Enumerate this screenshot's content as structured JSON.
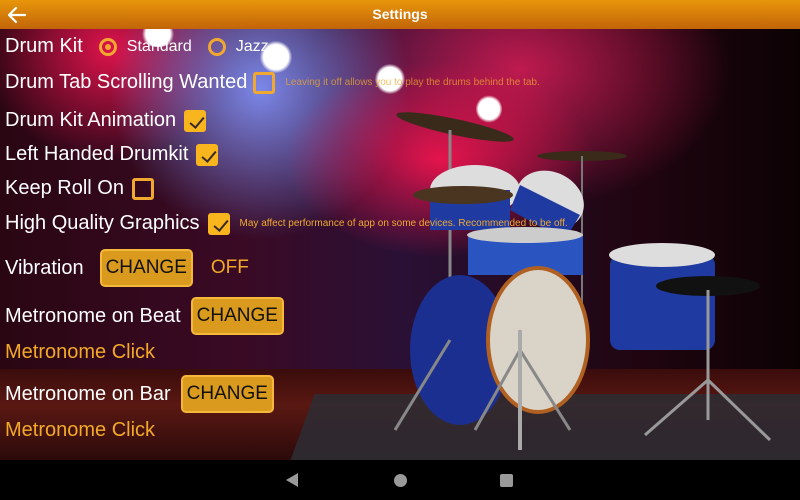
{
  "appbar": {
    "title": "Settings",
    "back_icon": "arrow-left-icon"
  },
  "settings": {
    "drum_kit": {
      "label": "Drum Kit",
      "options": [
        {
          "label": "Standard",
          "selected": true
        },
        {
          "label": "Jazz",
          "selected": false
        }
      ]
    },
    "drum_tab_scrolling": {
      "label": "Drum Tab Scrolling Wanted",
      "checked": false,
      "hint": "Leaving it off allows you to play the drums behind the tab."
    },
    "drum_kit_animation": {
      "label": "Drum Kit Animation",
      "checked": true
    },
    "left_handed": {
      "label": "Left Handed Drumkit",
      "checked": true
    },
    "keep_roll_on": {
      "label": "Keep Roll On",
      "checked": false
    },
    "high_quality_graphics": {
      "label": "High Quality Graphics",
      "checked": true,
      "hint": "May affect performance of app on some devices. Recommended to be off."
    },
    "vibration": {
      "label": "Vibration",
      "button": "CHANGE",
      "value": "OFF"
    },
    "metronome_beat": {
      "label": "Metronome on Beat",
      "button": "CHANGE",
      "value": "Metronome Click"
    },
    "metronome_bar": {
      "label": "Metronome on Bar",
      "button": "CHANGE",
      "value": "Metronome Click"
    }
  },
  "navbar": {
    "back_icon": "triangle-back-icon",
    "home_icon": "circle-home-icon",
    "recents_icon": "square-recents-icon"
  },
  "colors": {
    "accent": "#f0a830",
    "appbar_top": "#e8960a",
    "appbar_bottom": "#c2640a",
    "button_fill": "#d99a1e"
  }
}
